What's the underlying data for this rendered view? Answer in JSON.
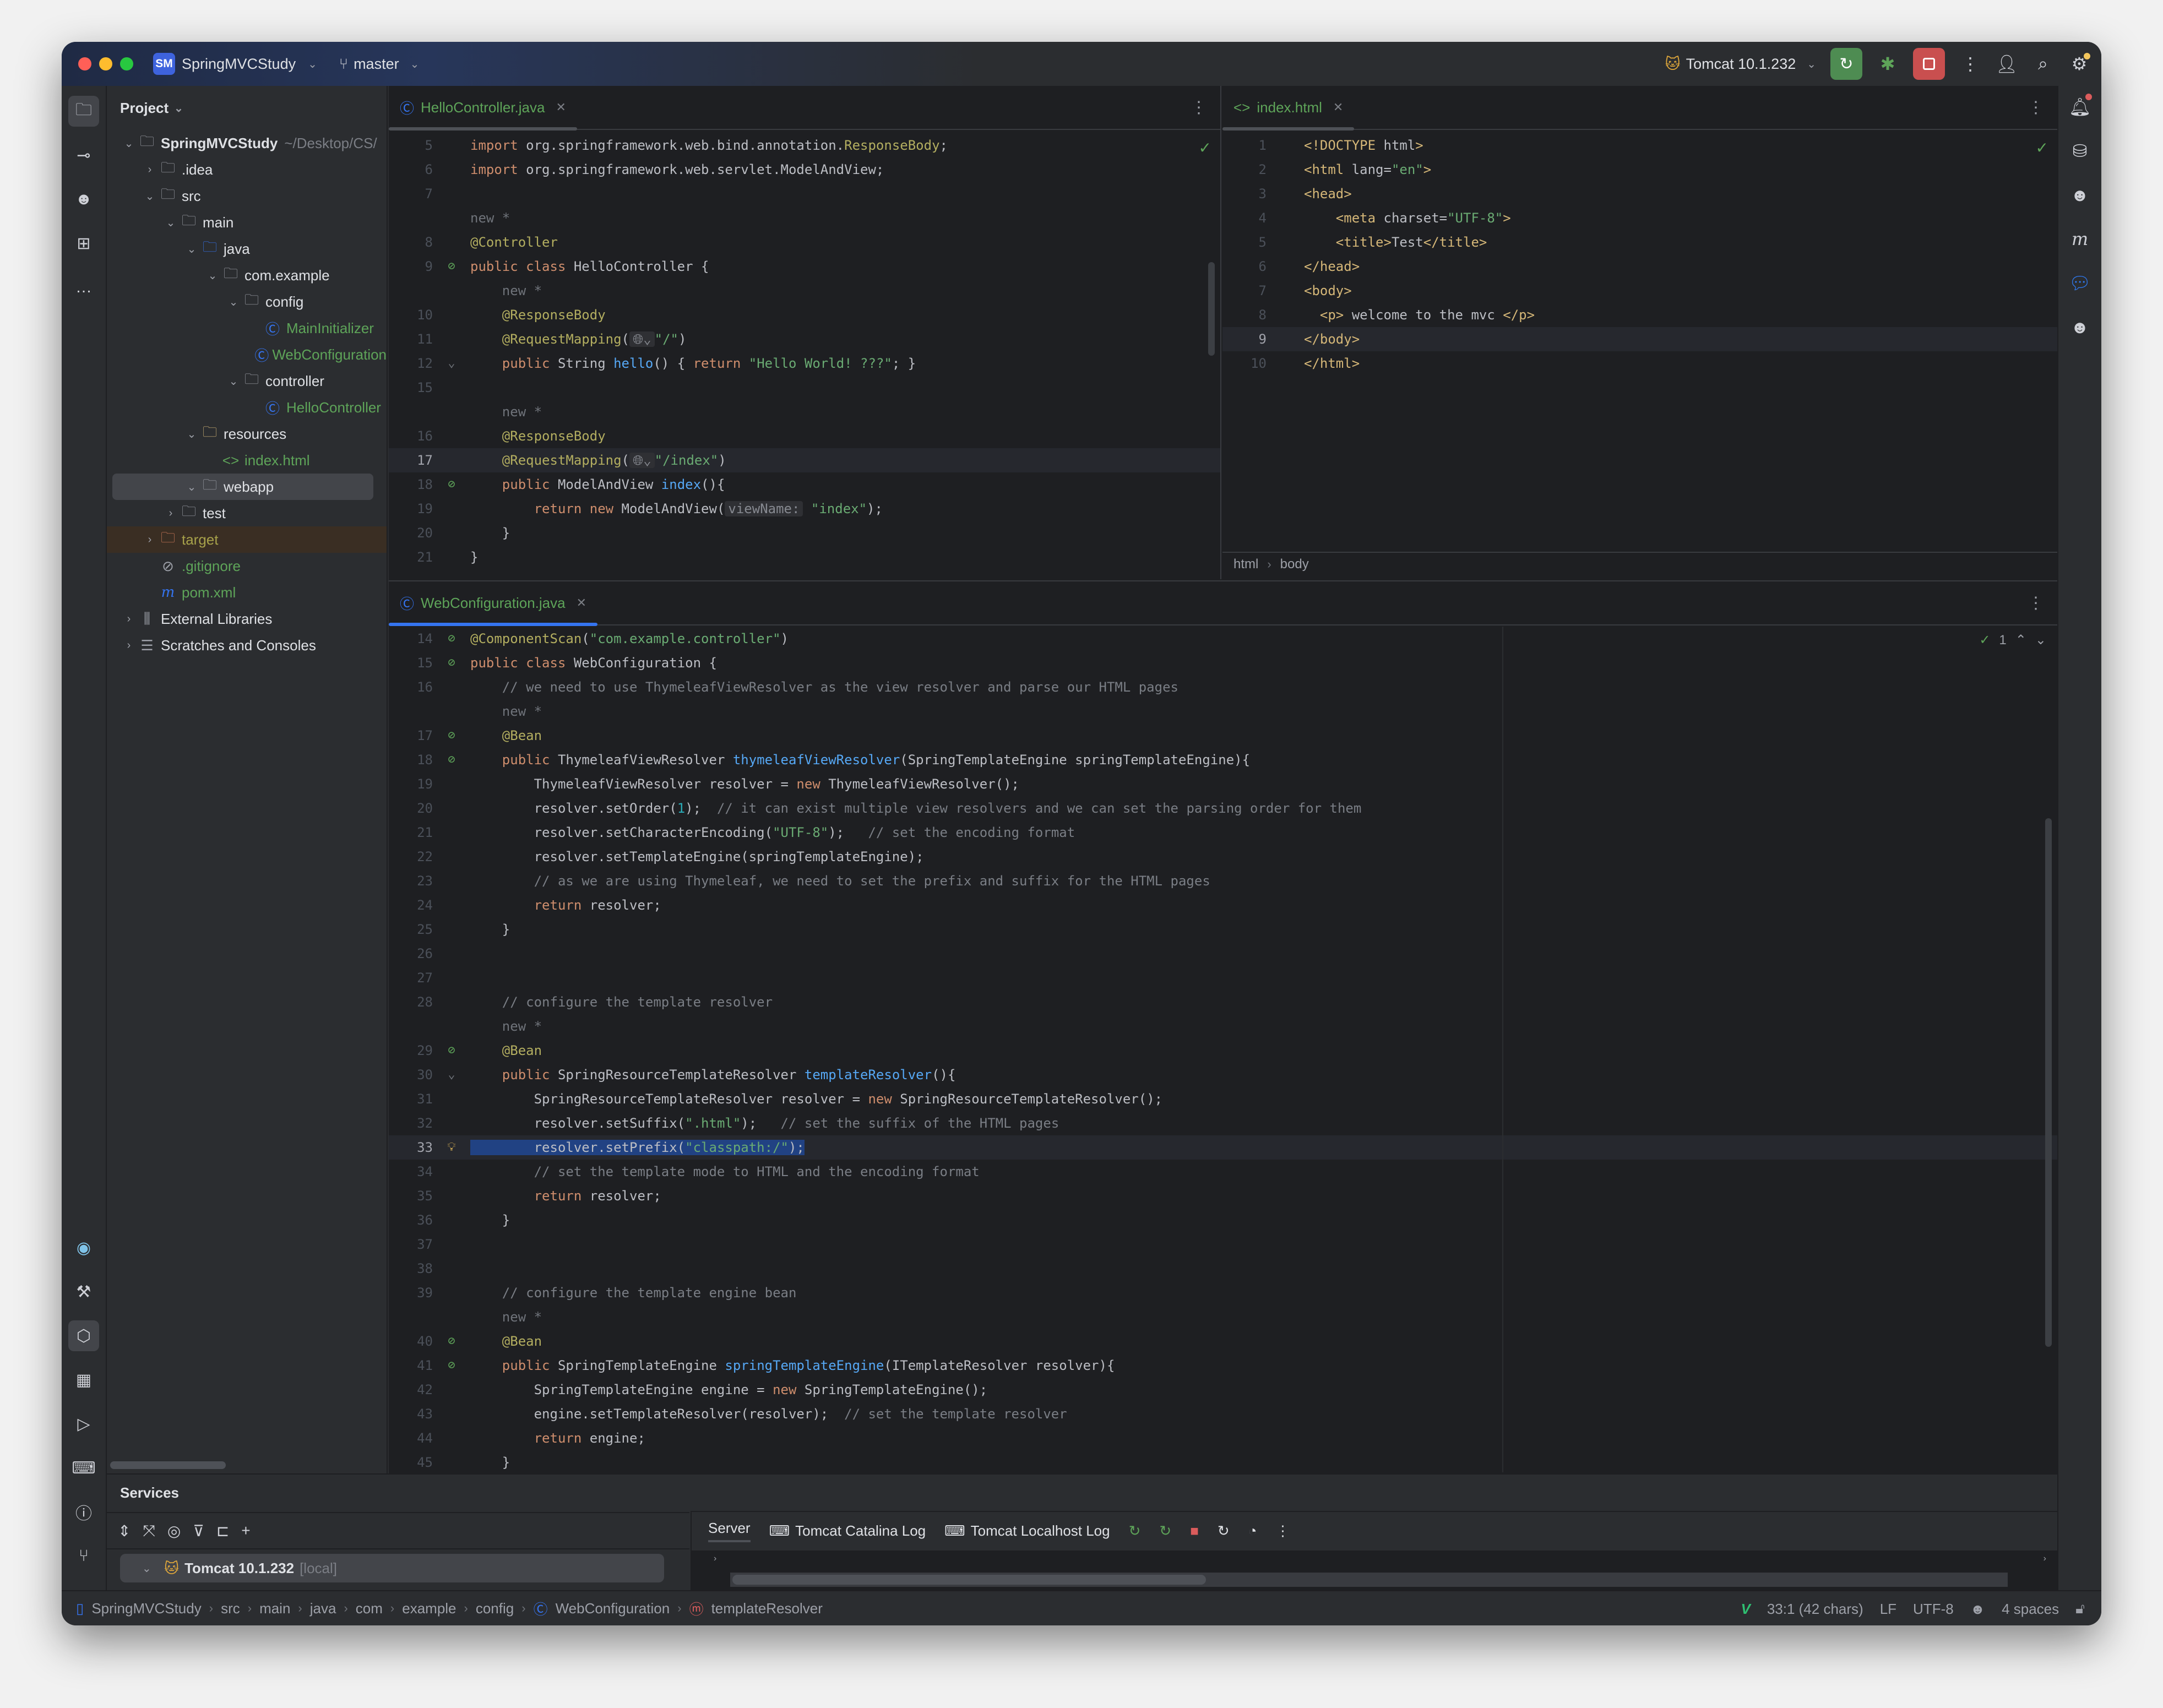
{
  "titlebar": {
    "project_badge": "SM",
    "project_name": "SpringMVCStudy",
    "branch": "master",
    "run_config": "Tomcat 10.1.232",
    "traffic_colors": [
      "#ff5f57",
      "#febc2e",
      "#28c840"
    ],
    "run_button_color": "#4e8c52",
    "stop_button_color": "#c94f4f"
  },
  "project_panel": {
    "title": "Project",
    "tree": [
      {
        "label": "SpringMVCStudy",
        "suffix": "~/Desktop/CS/",
        "depth": 0,
        "arrow": "open",
        "icon": "module-folder-icon",
        "bold": true
      },
      {
        "label": ".idea",
        "depth": 1,
        "arrow": "closed",
        "icon": "folder-icon"
      },
      {
        "label": "src",
        "depth": 1,
        "arrow": "open",
        "icon": "folder-icon"
      },
      {
        "label": "main",
        "depth": 2,
        "arrow": "open",
        "icon": "folder-icon"
      },
      {
        "label": "java",
        "depth": 3,
        "arrow": "open",
        "icon": "source-folder-icon"
      },
      {
        "label": "com.example",
        "depth": 4,
        "arrow": "open",
        "icon": "package-icon"
      },
      {
        "label": "config",
        "depth": 5,
        "arrow": "open",
        "icon": "package-icon"
      },
      {
        "label": "MainInitializer",
        "depth": 6,
        "arrow": "",
        "icon": "class-icon",
        "color": "green"
      },
      {
        "label": "WebConfiguration",
        "depth": 6,
        "arrow": "",
        "icon": "class-icon",
        "color": "green"
      },
      {
        "label": "controller",
        "depth": 5,
        "arrow": "open",
        "icon": "package-icon"
      },
      {
        "label": "HelloController",
        "depth": 6,
        "arrow": "",
        "icon": "class-icon",
        "color": "green"
      },
      {
        "label": "resources",
        "depth": 3,
        "arrow": "open",
        "icon": "resources-folder-icon"
      },
      {
        "label": "index.html",
        "depth": 4,
        "arrow": "",
        "icon": "html-icon",
        "color": "green"
      },
      {
        "label": "webapp",
        "depth": 3,
        "arrow": "open",
        "icon": "web-folder-icon",
        "selected": true
      },
      {
        "label": "test",
        "depth": 2,
        "arrow": "closed",
        "icon": "folder-icon"
      },
      {
        "label": "target",
        "depth": 1,
        "arrow": "closed",
        "icon": "excluded-folder-icon",
        "color": "olive",
        "ignored": true
      },
      {
        "label": ".gitignore",
        "depth": 1,
        "arrow": "",
        "icon": "ignore-file-icon",
        "color": "green"
      },
      {
        "label": "pom.xml",
        "depth": 1,
        "arrow": "",
        "icon": "maven-icon",
        "color": "green"
      },
      {
        "label": "External Libraries",
        "depth": 0,
        "arrow": "closed",
        "icon": "libraries-icon"
      },
      {
        "label": "Scratches and Consoles",
        "depth": 0,
        "arrow": "closed",
        "icon": "scratches-icon"
      }
    ]
  },
  "editor_hello": {
    "tab_label": "HelloController.java",
    "lines": [
      {
        "n": "5",
        "segs": [
          [
            "kw",
            "import "
          ],
          [
            "txt",
            "org.springframework.web.bind.annotation."
          ],
          [
            "ann",
            "ResponseBody"
          ],
          [
            "txt",
            ";"
          ]
        ]
      },
      {
        "n": "6",
        "segs": [
          [
            "kw",
            "import "
          ],
          [
            "txt",
            "org.springframework.web.servlet.ModelAndView;"
          ]
        ]
      },
      {
        "n": "7",
        "segs": []
      },
      {
        "n": "",
        "segs": [
          [
            "hint",
            "new *"
          ]
        ]
      },
      {
        "n": "8",
        "segs": [
          [
            "ann",
            "@Controller"
          ]
        ]
      },
      {
        "n": "9",
        "gutter": "bean-icon",
        "segs": [
          [
            "kw",
            "public class "
          ],
          [
            "txt",
            "HelloController {"
          ]
        ]
      },
      {
        "n": "",
        "segs": [
          [
            "hint",
            "    new *"
          ]
        ]
      },
      {
        "n": "10",
        "segs": [
          [
            "txt",
            "    "
          ],
          [
            "ann",
            "@ResponseBody"
          ]
        ]
      },
      {
        "n": "11",
        "segs": [
          [
            "txt",
            "    "
          ],
          [
            "ann",
            "@RequestMapping"
          ],
          [
            "txt",
            "("
          ],
          [
            "inlay",
            "🌐︎⌄"
          ],
          [
            "str",
            "\"/\""
          ],
          [
            "txt",
            ")"
          ]
        ]
      },
      {
        "n": "12",
        "fold": true,
        "segs": [
          [
            "txt",
            "    "
          ],
          [
            "kw",
            "public "
          ],
          [
            "txt",
            "String "
          ],
          [
            "fn",
            "hello"
          ],
          [
            "txt",
            "() { "
          ],
          [
            "kw",
            "return "
          ],
          [
            "str",
            "\"Hello World! ???\""
          ],
          [
            "txt",
            "; }"
          ]
        ]
      },
      {
        "n": "15",
        "segs": []
      },
      {
        "n": "",
        "segs": [
          [
            "hint",
            "    new *"
          ]
        ]
      },
      {
        "n": "16",
        "segs": [
          [
            "txt",
            "    "
          ],
          [
            "ann",
            "@ResponseBody"
          ]
        ]
      },
      {
        "n": "17",
        "current": true,
        "segs": [
          [
            "txt",
            "    "
          ],
          [
            "ann",
            "@RequestMapping"
          ],
          [
            "txt",
            "("
          ],
          [
            "inlay",
            "🌐︎⌄"
          ],
          [
            "str",
            "\"/index\""
          ],
          [
            "txt",
            ")"
          ]
        ]
      },
      {
        "n": "18",
        "gutter": "endpoint-icon",
        "segs": [
          [
            "txt",
            "    "
          ],
          [
            "kw",
            "public "
          ],
          [
            "txt",
            "ModelAndView "
          ],
          [
            "fn",
            "index"
          ],
          [
            "txt",
            "(){"
          ]
        ]
      },
      {
        "n": "19",
        "segs": [
          [
            "txt",
            "        "
          ],
          [
            "kw",
            "return new "
          ],
          [
            "txt",
            "ModelAndView("
          ],
          [
            "inlay",
            "viewName:"
          ],
          [
            "txt",
            " "
          ],
          [
            "str",
            "\"index\""
          ],
          [
            "txt",
            ");"
          ]
        ]
      },
      {
        "n": "20",
        "segs": [
          [
            "txt",
            "    }"
          ]
        ]
      },
      {
        "n": "21",
        "segs": [
          [
            "txt",
            "}"
          ]
        ]
      }
    ]
  },
  "editor_index": {
    "tab_label": "index.html",
    "breadcrumb": [
      "html",
      "body"
    ],
    "lines": [
      {
        "n": "1",
        "segs": [
          [
            "tag",
            "<!DOCTYPE "
          ],
          [
            "txt",
            "html"
          ],
          [
            "tag",
            ">"
          ]
        ]
      },
      {
        "n": "2",
        "segs": [
          [
            "tag",
            "<html "
          ],
          [
            "txt",
            "lang"
          ],
          [
            "txt",
            "="
          ],
          [
            "str",
            "\"en\""
          ],
          [
            "tag",
            ">"
          ]
        ]
      },
      {
        "n": "3",
        "segs": [
          [
            "tag",
            "<head>"
          ]
        ]
      },
      {
        "n": "4",
        "segs": [
          [
            "txt",
            "    "
          ],
          [
            "tag",
            "<meta "
          ],
          [
            "txt",
            "charset="
          ],
          [
            "str",
            "\"UTF-8\""
          ],
          [
            "tag",
            ">"
          ]
        ]
      },
      {
        "n": "5",
        "segs": [
          [
            "txt",
            "    "
          ],
          [
            "tag",
            "<title>"
          ],
          [
            "txt",
            "Test"
          ],
          [
            "tag",
            "</title>"
          ]
        ]
      },
      {
        "n": "6",
        "segs": [
          [
            "tag",
            "</head>"
          ]
        ]
      },
      {
        "n": "7",
        "segs": [
          [
            "tag",
            "<body>"
          ]
        ]
      },
      {
        "n": "8",
        "segs": [
          [
            "txt",
            "  "
          ],
          [
            "tag",
            "<p>"
          ],
          [
            "txt",
            " welcome to the mvc "
          ],
          [
            "tag",
            "</p>"
          ]
        ]
      },
      {
        "n": "9",
        "current": true,
        "segs": [
          [
            "tag",
            "</body>"
          ]
        ]
      },
      {
        "n": "10",
        "segs": [
          [
            "tag",
            "</html>"
          ]
        ]
      }
    ]
  },
  "editor_web": {
    "tab_label": "WebConfiguration.java",
    "problems_count": "1",
    "lines": [
      {
        "n": "14",
        "gutter": "bean-icon",
        "segs": [
          [
            "ann",
            "@ComponentScan"
          ],
          [
            "txt",
            "("
          ],
          [
            "str",
            "\"com.example.controller\""
          ],
          [
            "txt",
            ")"
          ]
        ]
      },
      {
        "n": "15",
        "gutter": "bean-icon",
        "segs": [
          [
            "kw",
            "public class "
          ],
          [
            "txt",
            "WebConfiguration {"
          ]
        ]
      },
      {
        "n": "16",
        "segs": [
          [
            "txt",
            "    "
          ],
          [
            "cm",
            "// we need to use ThymeleafViewResolver as the view resolver and parse our HTML pages"
          ]
        ]
      },
      {
        "n": "",
        "segs": [
          [
            "hint",
            "    new *"
          ]
        ]
      },
      {
        "n": "17",
        "gutter": "bean-icon",
        "segs": [
          [
            "txt",
            "    "
          ],
          [
            "ann",
            "@Bean"
          ]
        ]
      },
      {
        "n": "18",
        "gutter": "bean-icon",
        "fold": true,
        "segs": [
          [
            "txt",
            "    "
          ],
          [
            "kw",
            "public "
          ],
          [
            "txt",
            "ThymeleafViewResolver "
          ],
          [
            "fn",
            "thymeleafViewResolver"
          ],
          [
            "txt",
            "(SpringTemplateEngine springTemplateEngine){"
          ]
        ]
      },
      {
        "n": "19",
        "segs": [
          [
            "txt",
            "        ThymeleafViewResolver resolver = "
          ],
          [
            "kw",
            "new "
          ],
          [
            "txt",
            "ThymeleafViewResolver();"
          ]
        ]
      },
      {
        "n": "20",
        "segs": [
          [
            "txt",
            "        resolver.setOrder("
          ],
          [
            "num",
            "1"
          ],
          [
            "txt",
            ");  "
          ],
          [
            "cm",
            "// it can exist multiple view resolvers and we can set the parsing order for them"
          ]
        ]
      },
      {
        "n": "21",
        "segs": [
          [
            "txt",
            "        resolver.setCharacterEncoding("
          ],
          [
            "str",
            "\"UTF-8\""
          ],
          [
            "txt",
            ");   "
          ],
          [
            "cm",
            "// set the encoding format"
          ]
        ]
      },
      {
        "n": "22",
        "segs": [
          [
            "txt",
            "        resolver.setTemplateEngine(springTemplateEngine);"
          ]
        ]
      },
      {
        "n": "23",
        "segs": [
          [
            "txt",
            "        "
          ],
          [
            "cm",
            "// as we are using Thymeleaf, we need to set the prefix and suffix for the HTML pages"
          ]
        ]
      },
      {
        "n": "24",
        "segs": [
          [
            "txt",
            "        "
          ],
          [
            "kw",
            "return "
          ],
          [
            "txt",
            "resolver;"
          ]
        ]
      },
      {
        "n": "25",
        "segs": [
          [
            "txt",
            "    }"
          ]
        ]
      },
      {
        "n": "26",
        "segs": []
      },
      {
        "n": "27",
        "segs": []
      },
      {
        "n": "28",
        "segs": [
          [
            "txt",
            "    "
          ],
          [
            "cm",
            "// configure the template resolver"
          ]
        ]
      },
      {
        "n": "",
        "segs": [
          [
            "hint",
            "    new *"
          ]
        ]
      },
      {
        "n": "29",
        "gutter": "bean-icon",
        "segs": [
          [
            "txt",
            "    "
          ],
          [
            "ann",
            "@Bean"
          ]
        ]
      },
      {
        "n": "30",
        "fold": true,
        "segs": [
          [
            "txt",
            "    "
          ],
          [
            "kw",
            "public "
          ],
          [
            "txt",
            "SpringResourceTemplateResolver "
          ],
          [
            "fn",
            "templateResolver"
          ],
          [
            "txt",
            "(){"
          ]
        ]
      },
      {
        "n": "31",
        "segs": [
          [
            "txt",
            "        SpringResourceTemplateResolver resolver = "
          ],
          [
            "kw",
            "new "
          ],
          [
            "txt",
            "SpringResourceTemplateResolver();"
          ]
        ]
      },
      {
        "n": "32",
        "segs": [
          [
            "txt",
            "        resolver.setSuffix("
          ],
          [
            "str",
            "\".html\""
          ],
          [
            "txt",
            ");   "
          ],
          [
            "cm",
            "// set the suffix of the HTML pages"
          ]
        ]
      },
      {
        "n": "33",
        "current": true,
        "selected": true,
        "gutter": "bulb-icon",
        "segs": [
          [
            "txt",
            "        resolver.setPrefix("
          ],
          [
            "str",
            "\"classpath:/\""
          ],
          [
            "txt",
            ");"
          ]
        ]
      },
      {
        "n": "34",
        "segs": [
          [
            "txt",
            "        "
          ],
          [
            "cm",
            "// set the template mode to HTML and the encoding format"
          ]
        ]
      },
      {
        "n": "35",
        "segs": [
          [
            "txt",
            "        "
          ],
          [
            "kw",
            "return "
          ],
          [
            "txt",
            "resolver;"
          ]
        ]
      },
      {
        "n": "36",
        "segs": [
          [
            "txt",
            "    }"
          ]
        ]
      },
      {
        "n": "37",
        "segs": []
      },
      {
        "n": "38",
        "segs": []
      },
      {
        "n": "39",
        "segs": [
          [
            "txt",
            "    "
          ],
          [
            "cm",
            "// configure the template engine bean"
          ]
        ]
      },
      {
        "n": "",
        "segs": [
          [
            "hint",
            "    new *"
          ]
        ]
      },
      {
        "n": "40",
        "gutter": "bean-icon",
        "segs": [
          [
            "txt",
            "    "
          ],
          [
            "ann",
            "@Bean"
          ]
        ]
      },
      {
        "n": "41",
        "gutter": "bean-icon",
        "fold": true,
        "segs": [
          [
            "txt",
            "    "
          ],
          [
            "kw",
            "public "
          ],
          [
            "txt",
            "SpringTemplateEngine "
          ],
          [
            "fn",
            "springTemplateEngine"
          ],
          [
            "txt",
            "(ITemplateResolver resolver){"
          ]
        ]
      },
      {
        "n": "42",
        "segs": [
          [
            "txt",
            "        SpringTemplateEngine engine = "
          ],
          [
            "kw",
            "new "
          ],
          [
            "txt",
            "SpringTemplateEngine();"
          ]
        ]
      },
      {
        "n": "43",
        "segs": [
          [
            "txt",
            "        engine.setTemplateResolver(resolver);  "
          ],
          [
            "cm",
            "// set the template resolver"
          ]
        ]
      },
      {
        "n": "44",
        "segs": [
          [
            "txt",
            "        "
          ],
          [
            "kw",
            "return "
          ],
          [
            "txt",
            "engine;"
          ]
        ]
      },
      {
        "n": "45",
        "segs": [
          [
            "txt",
            "    }"
          ]
        ]
      }
    ]
  },
  "services": {
    "title": "Services",
    "node_label": "Tomcat 10.1.232",
    "node_suffix": "[local]",
    "tabs": [
      "Server",
      "Tomcat Catalina Log",
      "Tomcat Localhost Log"
    ]
  },
  "statusbar": {
    "path": [
      "SpringMVCStudy",
      "src",
      "main",
      "java",
      "com",
      "example",
      "config",
      "WebConfiguration",
      "templateResolver"
    ],
    "position": "33:1 (42 chars)",
    "line_ending": "LF",
    "encoding": "UTF-8",
    "indent": "4 spaces"
  }
}
